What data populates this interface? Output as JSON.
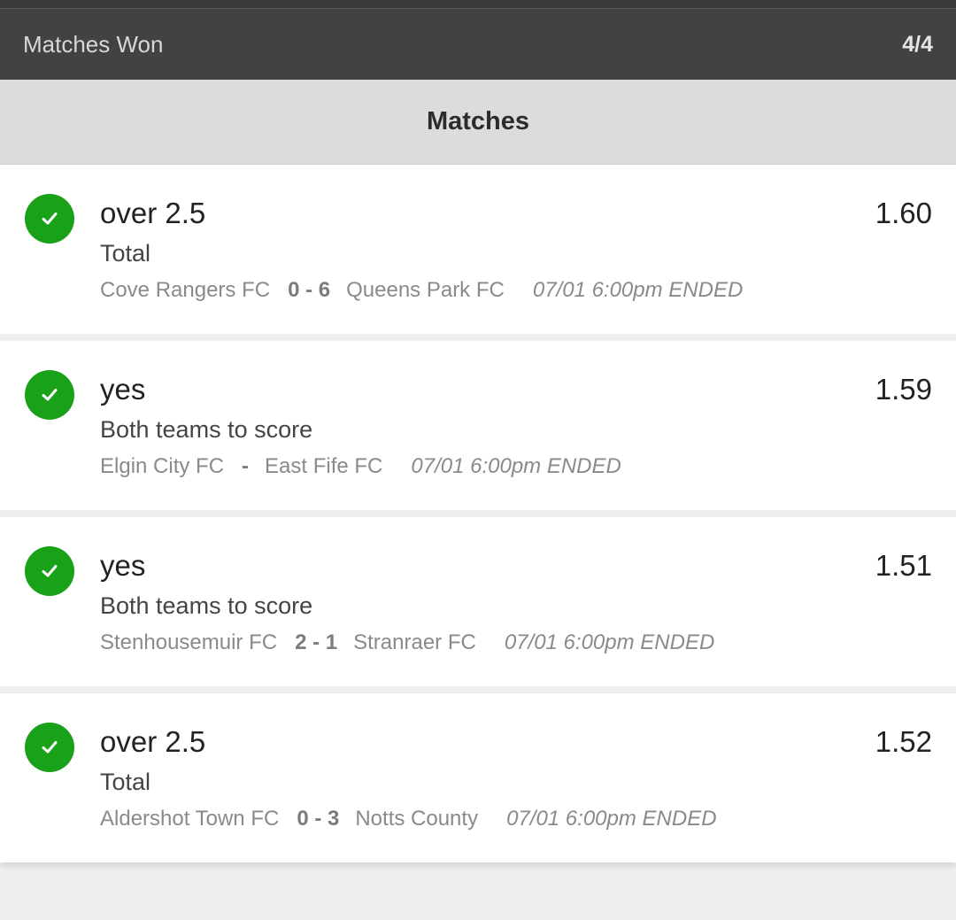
{
  "summary": {
    "label": "Matches Won",
    "value": "4/4"
  },
  "section": {
    "title": "Matches"
  },
  "colors": {
    "win": "#1aa11a",
    "summary_bg": "#424242",
    "header_bg": "#dcdcdc"
  },
  "icons": {
    "status": "check-icon"
  },
  "matches": [
    {
      "pick": "over 2.5",
      "odds": "1.60",
      "market": "Total",
      "home": "Cove Rangers FC",
      "score": "0 - 6",
      "away": "Queens Park FC",
      "when": "07/01 6:00pm ENDED"
    },
    {
      "pick": "yes",
      "odds": "1.59",
      "market": "Both teams to score",
      "home": "Elgin City FC",
      "score": "-",
      "away": "East Fife FC",
      "when": "07/01 6:00pm ENDED"
    },
    {
      "pick": "yes",
      "odds": "1.51",
      "market": "Both teams to score",
      "home": "Stenhousemuir FC",
      "score": "2 - 1",
      "away": "Stranraer FC",
      "when": "07/01 6:00pm ENDED"
    },
    {
      "pick": "over 2.5",
      "odds": "1.52",
      "market": "Total",
      "home": "Aldershot Town FC",
      "score": "0 - 3",
      "away": "Notts County",
      "when": "07/01 6:00pm ENDED"
    }
  ]
}
